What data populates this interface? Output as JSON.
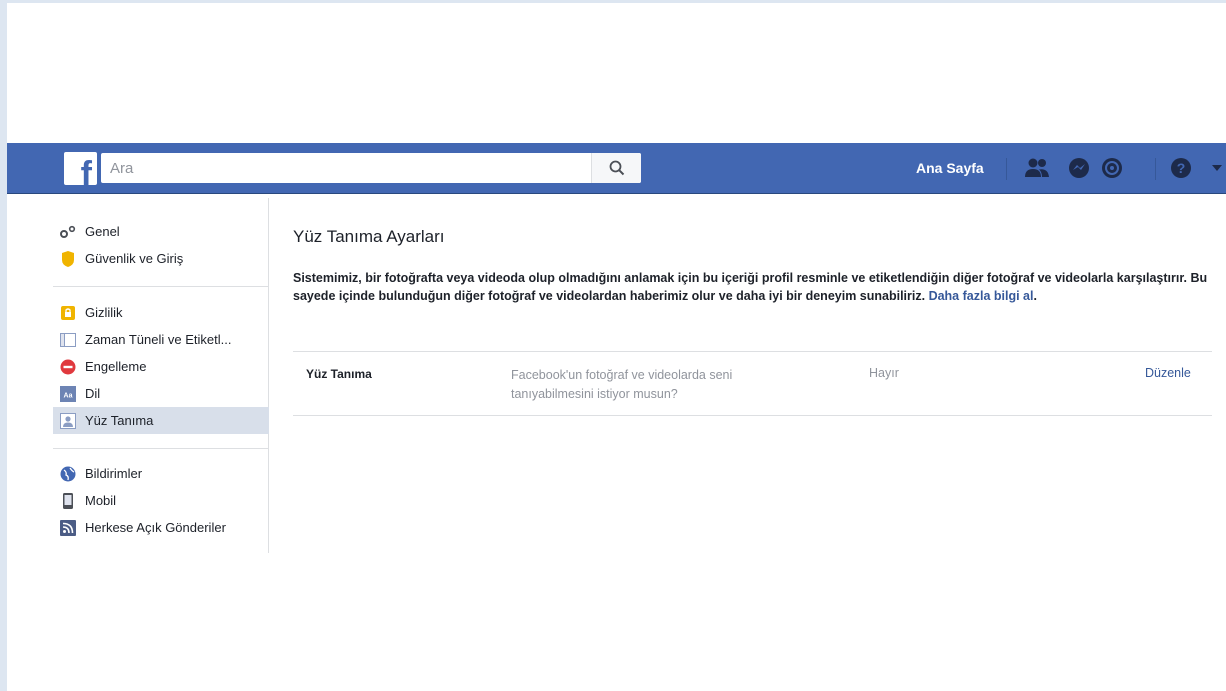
{
  "colors": {
    "topbar": "#4267b2",
    "link": "#365899",
    "active_item": "#d8dfea",
    "muted_text": "#90949c"
  },
  "header": {
    "logo_letter": "f",
    "search_placeholder": "Ara",
    "home_label": "Ana Sayfa",
    "icons": [
      "friends-icon",
      "messenger-icon",
      "notifications-icon",
      "help-icon",
      "dropdown-arrow-icon"
    ]
  },
  "sidebar": {
    "group1": [
      {
        "label": "Genel",
        "icon": "gear-icon"
      },
      {
        "label": "Güvenlik ve Giriş",
        "icon": "shield-icon"
      }
    ],
    "group2": [
      {
        "label": "Gizlilik",
        "icon": "lock-icon"
      },
      {
        "label": "Zaman Tüneli ve Etiketl...",
        "icon": "timeline-icon"
      },
      {
        "label": "Engelleme",
        "icon": "block-icon"
      },
      {
        "label": "Dil",
        "icon": "language-icon"
      },
      {
        "label": "Yüz Tanıma",
        "icon": "face-recognition-icon",
        "active": true
      }
    ],
    "group3": [
      {
        "label": "Bildirimler",
        "icon": "globe-icon"
      },
      {
        "label": "Mobil",
        "icon": "mobile-icon"
      },
      {
        "label": "Herkese Açık Gönderiler",
        "icon": "rss-icon"
      }
    ]
  },
  "main": {
    "title": "Yüz Tanıma Ayarları",
    "description": "Sistemimiz, bir fotoğrafta veya videoda olup olmadığını anlamak için bu içeriği profil resminle ve etiketlendiğin diğer fotoğraf ve videolarla karşılaştırır. Bu sayede içinde bulunduğun diğer fotoğraf ve videolardan haberimiz olur ve daha iyi bir deneyim sunabiliriz.",
    "learn_more": "Daha fazla bilgi al",
    "learn_more_suffix": ".",
    "setting": {
      "name": "Yüz Tanıma",
      "question": "Facebook'un fotoğraf ve videolarda seni tanıyabilmesini istiyor musun?",
      "value": "Hayır",
      "edit": "Düzenle"
    }
  }
}
